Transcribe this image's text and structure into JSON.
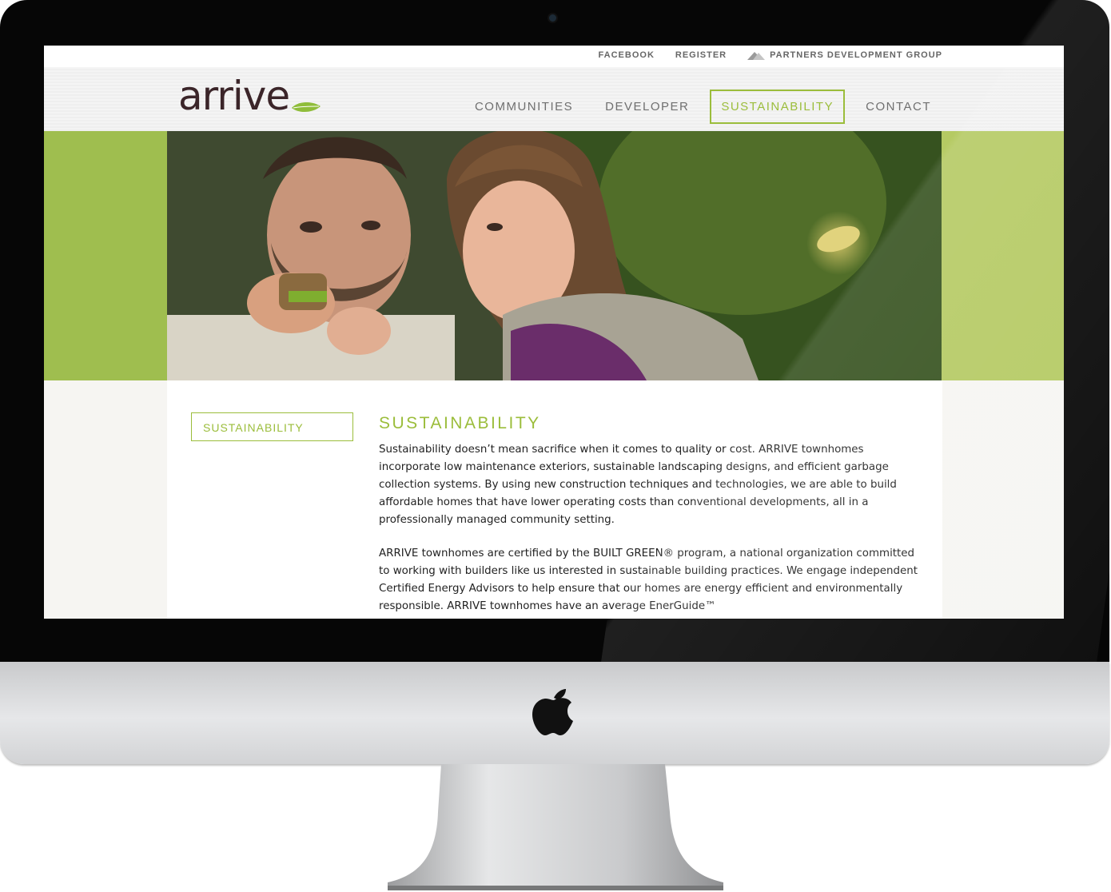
{
  "top_links": {
    "facebook": "FACEBOOK",
    "register": "REGISTER",
    "partners": "PARTNERS DEVELOPMENT GROUP"
  },
  "logo": {
    "text": "arrive"
  },
  "nav": {
    "items": [
      {
        "label": "COMMUNITIES"
      },
      {
        "label": "DEVELOPER"
      },
      {
        "label": "SUSTAINABILITY"
      },
      {
        "label": "CONTACT"
      }
    ],
    "active_index": 2
  },
  "sidebar": {
    "label": "SUSTAINABILITY"
  },
  "main": {
    "heading": "SUSTAINABILITY",
    "paragraphs": [
      "Sustainability doesn’t mean sacrifice when it comes to quality or cost. ARRIVE townhomes incorporate low maintenance exteriors, sustainable landscaping designs, and efficient garbage collection systems. By using new construction techniques and technologies, we are able to build affordable homes that have lower operating costs than conventional developments, all in a professionally managed community setting.",
      "ARRIVE townhomes are certified by the BUILT GREEN® program, a national organization committed to working with builders like us interested in sustainable building practices. We engage independent Certified Energy Advisors to help ensure that our homes are energy efficient and environmentally responsible. ARRIVE townhomes have an average EnerGuide™"
    ]
  },
  "colors": {
    "accent_green": "#9bbd3b",
    "hero_band_green": "#b5ca62",
    "logo_brown": "#3b2529",
    "nav_gray": "#6f6f6f"
  },
  "icons": [
    "partners-development-group-icon",
    "leaf-icon",
    "apple-logo-icon",
    "webcam-icon"
  ]
}
